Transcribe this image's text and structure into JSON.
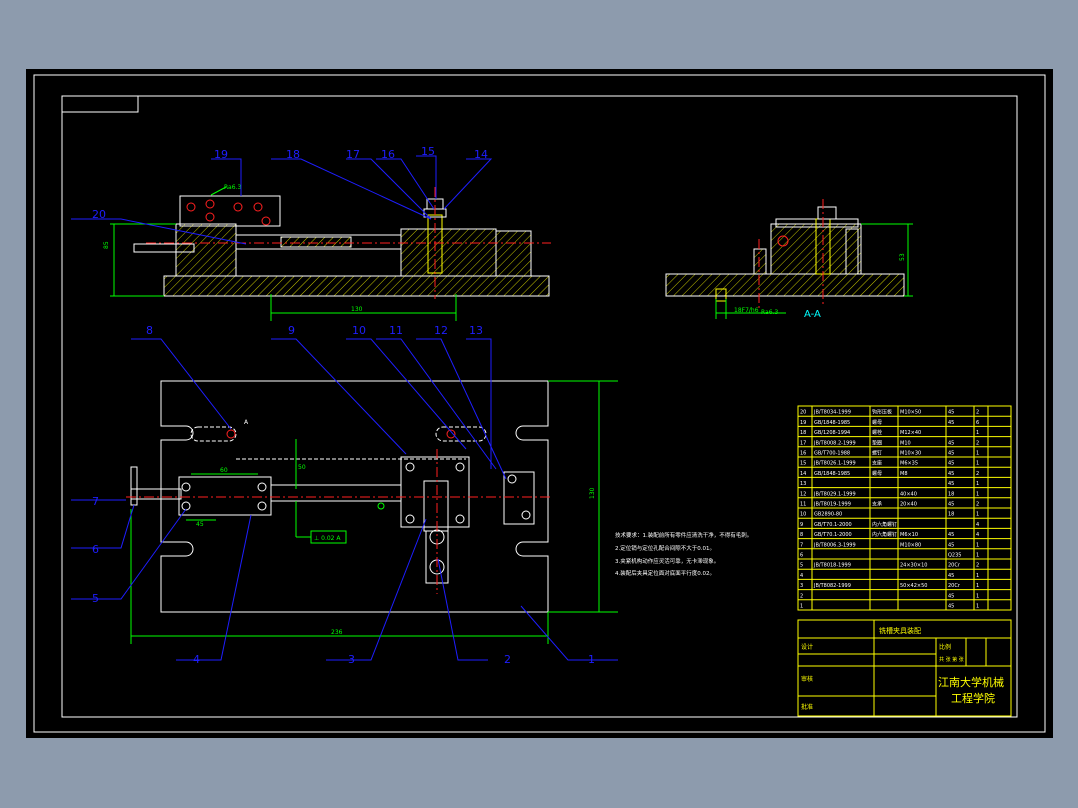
{
  "balloons": {
    "b1": "1",
    "b2": "2",
    "b3": "3",
    "b4": "4",
    "b5": "5",
    "b6": "6",
    "b7": "7",
    "b8": "8",
    "b9": "9",
    "b10": "10",
    "b11": "11",
    "b12": "12",
    "b13": "13",
    "b14": "14",
    "b15": "15",
    "b16": "16",
    "b17": "17",
    "b18": "18",
    "b19": "19",
    "b20": "20"
  },
  "dimensions": {
    "front_width": "130",
    "front_height": "85",
    "plan_width": "236",
    "plan_height": "130",
    "plan_offset_h": "60",
    "plan_offset_v": "50",
    "plan_small": "45",
    "side_height": "53",
    "side_fit": "18F7/h6"
  },
  "annotations": {
    "section_marker": "A",
    "section_label": "A-A",
    "surface_note": "Ra6.3",
    "tolerance_frame": "⊥ 0.02 A"
  },
  "notes": [
    "技术要求：1.装配前所有零件应清洗干净，不得有毛刺。",
    "2.定位销与定位孔配合间隙不大于0.01。",
    "3.夹紧机构动作应灵活可靠，无卡滞现象。",
    "4.装配后夹具定位面对底面平行度0.02。"
  ],
  "bom": [
    {
      "no": "20",
      "code": "JB/T8034-1999",
      "name": "钩形压板",
      "spec": "M10×50",
      "mat": "45",
      "qty": "2"
    },
    {
      "no": "19",
      "code": "GB/1848-1985",
      "name": "螺母",
      "spec": "",
      "mat": "45",
      "qty": "6"
    },
    {
      "no": "18",
      "code": "GB/1208-1994",
      "name": "螺栓",
      "spec": "M12×40",
      "mat": "",
      "qty": "1"
    },
    {
      "no": "17",
      "code": "JB/T8008.2-1999",
      "name": "垫圈",
      "spec": "M10",
      "mat": "45",
      "qty": "2"
    },
    {
      "no": "16",
      "code": "GB/T700-1988",
      "name": "螺钉",
      "spec": "M10×30",
      "mat": "45",
      "qty": "1"
    },
    {
      "no": "15",
      "code": "JB/T8026.1-1999",
      "name": "支座",
      "spec": "M6×35",
      "mat": "45",
      "qty": "1"
    },
    {
      "no": "14",
      "code": "GB/1848-1985",
      "name": "螺母",
      "spec": "M8",
      "mat": "45",
      "qty": "2"
    },
    {
      "no": "13",
      "code": "",
      "name": "",
      "spec": "",
      "mat": "45",
      "qty": "1"
    },
    {
      "no": "12",
      "code": "JB/T8029.1-1999",
      "name": "",
      "spec": "40×40",
      "mat": "18",
      "qty": "1"
    },
    {
      "no": "11",
      "code": "JB/T8019-1999",
      "name": "支承",
      "spec": "20×40",
      "mat": "45",
      "qty": "2"
    },
    {
      "no": "10",
      "code": "GB2890-80",
      "name": "",
      "spec": "",
      "mat": "18",
      "qty": "1"
    },
    {
      "no": "9",
      "code": "GB/T70.1-2000",
      "name": "内六角螺钉",
      "spec": "",
      "mat": "",
      "qty": "4"
    },
    {
      "no": "8",
      "code": "GB/T70.1-2000",
      "name": "内六角螺钉",
      "spec": "M6×10",
      "mat": "45",
      "qty": "4"
    },
    {
      "no": "7",
      "code": "JB/T8006.3-1999",
      "name": "",
      "spec": "M10×80",
      "mat": "45",
      "qty": "1"
    },
    {
      "no": "6",
      "code": "",
      "name": "",
      "spec": "",
      "mat": "Q235",
      "qty": "1"
    },
    {
      "no": "5",
      "code": "JB/T8018-1999",
      "name": "",
      "spec": "24×30×10",
      "mat": "20Cr",
      "qty": "2"
    },
    {
      "no": "4",
      "code": "",
      "name": "",
      "spec": "",
      "mat": "45",
      "qty": "1"
    },
    {
      "no": "3",
      "code": "JB/T8082-1999",
      "name": "",
      "spec": "50×42×50",
      "mat": "20Cr",
      "qty": "1"
    },
    {
      "no": "2",
      "code": "",
      "name": "",
      "spec": "",
      "mat": "45",
      "qty": "1"
    },
    {
      "no": "1",
      "code": "",
      "name": "",
      "spec": "",
      "mat": "45",
      "qty": "1"
    }
  ],
  "title_block": {
    "drawing_name": "铣槽夹具装配",
    "school_line1": "江南大学机械",
    "school_line2": "工程学院",
    "design": "设计",
    "check": "审核",
    "approve": "批准",
    "scale_label": "比例",
    "sheet_label": "共 张 第 张"
  },
  "colors": {
    "background": "#000000",
    "frame": "#ffffff",
    "leader": "#1e1eff",
    "dimension": "#00ff00",
    "part": "#ffffff",
    "hatch": "#c8c800",
    "yellow": "#ffff00",
    "red": "#ff2020",
    "cyan": "#00ffff",
    "magenta": "#ff40ff"
  }
}
